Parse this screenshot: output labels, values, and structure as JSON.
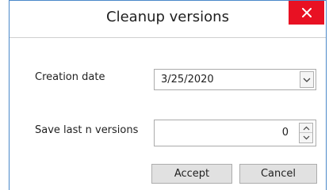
{
  "window": {
    "title": "Cleanup versions",
    "close_icon": "close-icon"
  },
  "form": {
    "creation_date_label": "Creation date",
    "creation_date_value": "3/25/2020",
    "save_last_label": "Save last n versions",
    "save_last_value": "0"
  },
  "buttons": {
    "accept": "Accept",
    "cancel": "Cancel"
  },
  "colors": {
    "close": "#e81123",
    "border": "#4a88c9"
  }
}
